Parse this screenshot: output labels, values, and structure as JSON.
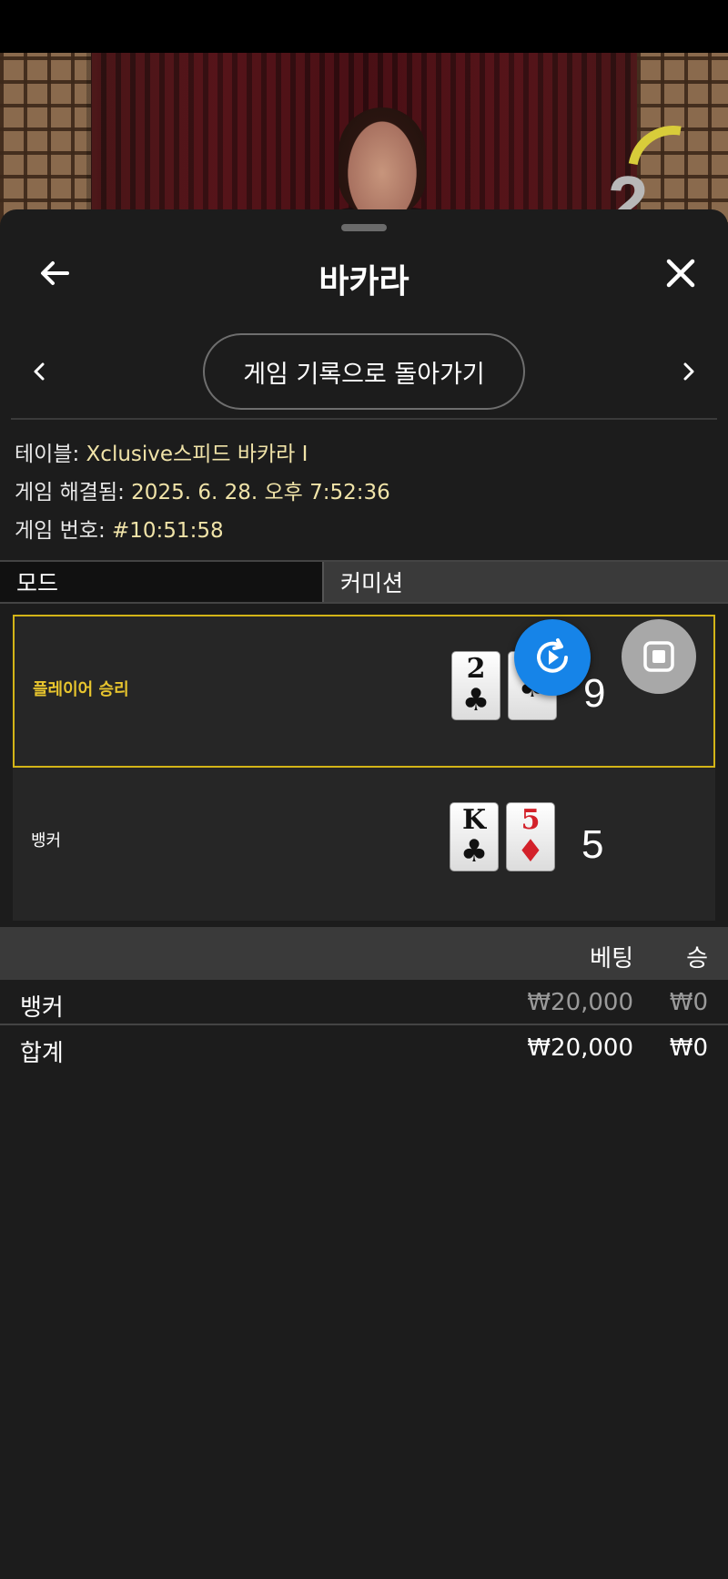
{
  "video": {
    "countdown": "2"
  },
  "header": {
    "title": "바카라"
  },
  "nav": {
    "history_button": "게임 기록으로 돌아가기"
  },
  "info": {
    "table_label": "테이블: ",
    "table_value": "Xclusive스피드 바카라 I",
    "resolved_label": "게임 해결됨: ",
    "resolved_value": "2025. 6. 28. 오후 7:52:36",
    "number_label": "게임 번호: ",
    "number_value": "#10:51:58"
  },
  "tabs": {
    "mode": "모드",
    "commission": "커미션"
  },
  "results": {
    "player": {
      "label": "플레이어 승리",
      "cards": [
        {
          "rank": "2",
          "suit": "♣",
          "color": "black"
        },
        {
          "rank": "",
          "suit": "♣",
          "color": "black"
        }
      ],
      "score": "9"
    },
    "banker": {
      "label": "뱅커",
      "cards": [
        {
          "rank": "K",
          "suit": "♣",
          "color": "black"
        },
        {
          "rank": "5",
          "suit": "♦",
          "color": "red"
        }
      ],
      "score": "5"
    }
  },
  "bets": {
    "header_bet": "베팅",
    "header_win": "승",
    "rows": [
      {
        "name": "뱅커",
        "bet": "₩20,000",
        "win": "₩0"
      }
    ],
    "total": {
      "name": "합계",
      "bet": "₩20,000",
      "win": "₩0"
    }
  },
  "colors": {
    "accent_yellow": "#d3b417",
    "replay_blue": "#1684e8",
    "value_text": "#f0e3a8"
  },
  "icons": {
    "back": "arrow-left-icon",
    "close": "close-icon",
    "prev": "chevron-left-icon",
    "next": "chevron-right-icon",
    "replay": "replay-icon",
    "stop": "stop-icon"
  }
}
